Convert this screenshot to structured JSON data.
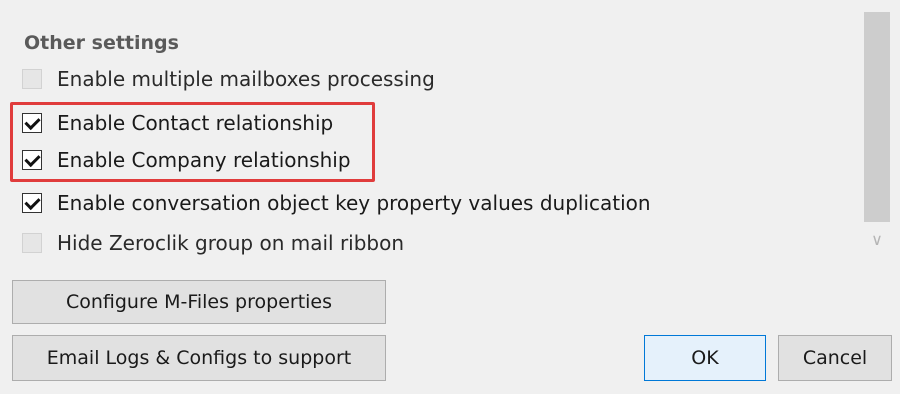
{
  "other_settings": {
    "title": "Other settings",
    "options": [
      {
        "label": "Enable multiple mailboxes processing",
        "checked": false,
        "enabled": false
      },
      {
        "label": "Enable Contact relationship",
        "checked": true,
        "enabled": true
      },
      {
        "label": "Enable Company relationship",
        "checked": true,
        "enabled": true
      },
      {
        "label": "Enable conversation object key property values duplication",
        "checked": true,
        "enabled": true
      },
      {
        "label": "Hide Zeroclik group on mail ribbon",
        "checked": false,
        "enabled": false
      }
    ]
  },
  "buttons": {
    "configure": "Configure M-Files properties",
    "email_logs": "Email Logs & Configs to support",
    "ok": "OK",
    "cancel": "Cancel"
  },
  "scrollbar": {
    "down_arrow_icon": "chevron-down-icon"
  },
  "highlight_color": "#e03c3c",
  "accent_color": "#0078d7"
}
